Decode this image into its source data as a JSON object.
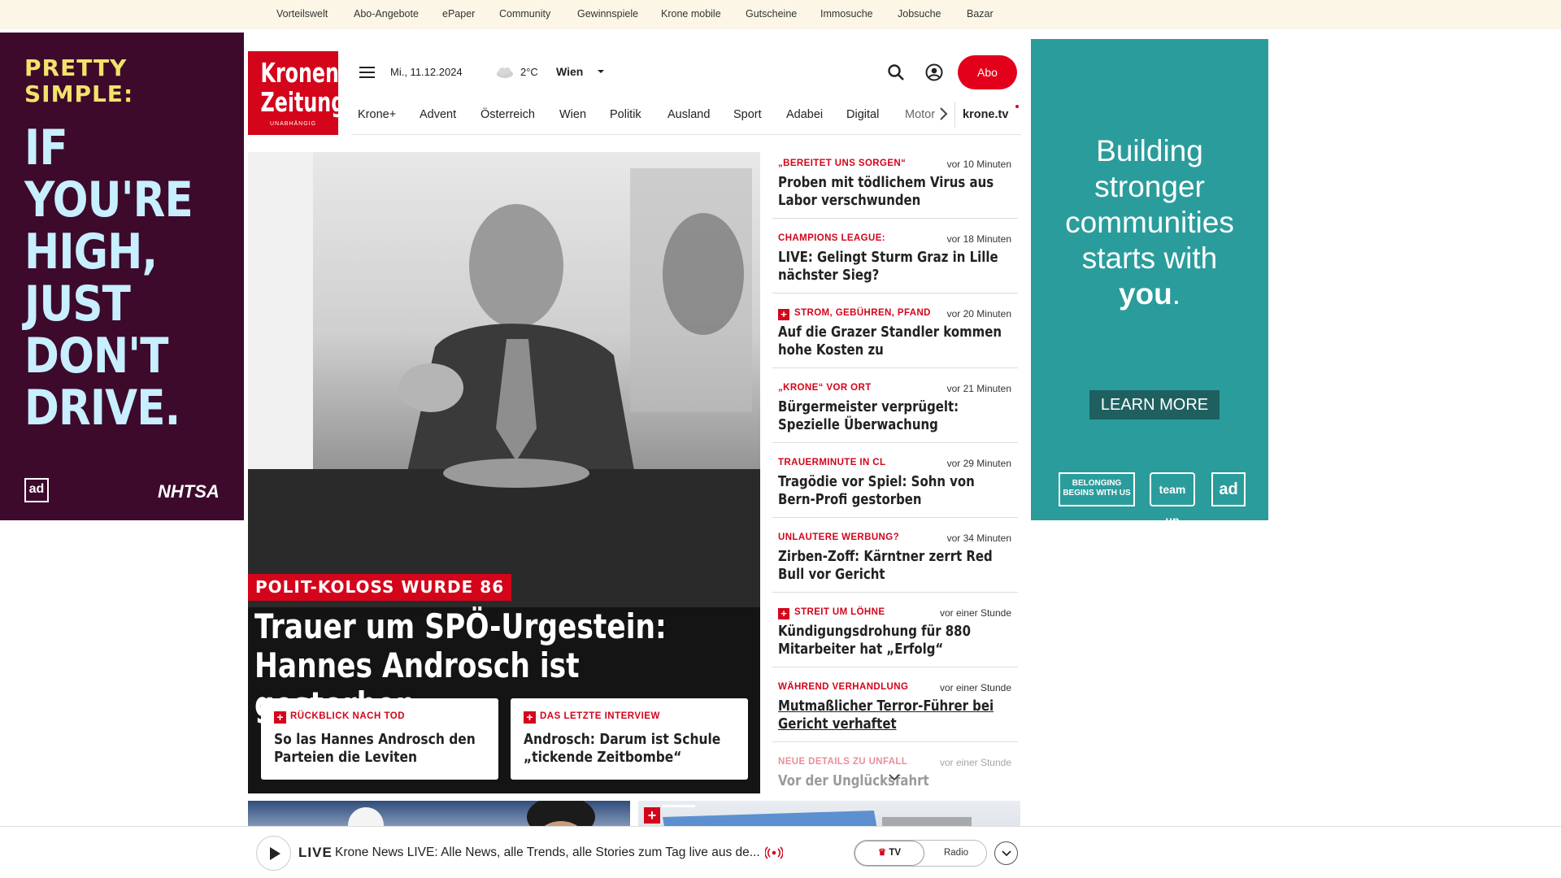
{
  "topbar": [
    "Vorteilswelt",
    "Abo-Angebote",
    "ePaper",
    "Community",
    "Gewinnspiele",
    "Krone mobile",
    "Gutscheine",
    "Immosuche",
    "Jobsuche",
    "Bazar"
  ],
  "ad_left": {
    "tagline": "PRETTY SIMPLE:",
    "headline": "IF YOU'RE HIGH, JUST DON'T DRIVE.",
    "logo1": "ad",
    "logo2": "NHTSA"
  },
  "ad_right": {
    "copy_line1": "Building",
    "copy_line2": "stronger",
    "copy_line3": "communities",
    "copy_line4": "starts with",
    "copy_bold": "you",
    "copy_end": ".",
    "button": "LEARN MORE",
    "logo1": "BELONGING BEGINS WITH US",
    "logo2": "team up",
    "logo3": "ad"
  },
  "header": {
    "logo_line1": "Kronen",
    "logo_line2": "Zeitung",
    "logo_line3": "UNABHÄNGIG",
    "date": "Mi., 11.12.2024",
    "temperature": "2°C",
    "location": "Wien",
    "abo_label": "Abo"
  },
  "nav": [
    "Krone+",
    "Advent",
    "Österreich",
    "Wien",
    "Politik",
    "Ausland",
    "Sport",
    "Adabei",
    "Digital",
    "Motor",
    "krone.tv"
  ],
  "hero": {
    "kicker": "POLIT-KOLOSS WURDE 86",
    "headline": "Trauer um SPÖ-Urgestein: Hannes Androsch ist gestorben",
    "related": [
      {
        "kicker": "RÜCKBLICK NACH TOD",
        "title": "So las Hannes Androsch den Parteien die Leviten"
      },
      {
        "kicker": "DAS LETZTE INTERVIEW",
        "title": "Androsch: Darum ist Schule „tickende Zeitbombe“"
      }
    ]
  },
  "articles": [
    {
      "kicker": "„BEREITET UNS SORGEN“",
      "time": "vor 10 Minuten",
      "title": "Proben mit tödlichem Virus aus Labor verschwunden",
      "plus": false
    },
    {
      "kicker": "CHAMPIONS LEAGUE:",
      "time": "vor 18 Minuten",
      "title": "LIVE: Gelingt Sturm Graz in Lille nächster Sieg?",
      "plus": false
    },
    {
      "kicker": "STROM, GEBÜHREN, PFAND",
      "time": "vor 20 Minuten",
      "title": "Auf die Grazer Standler kommen hohe Kosten zu",
      "plus": true
    },
    {
      "kicker": "„KRONE“ VOR ORT",
      "time": "vor 21 Minuten",
      "title": "Bürgermeister verprügelt: Spezielle Überwachung",
      "plus": false
    },
    {
      "kicker": "TRAUERMINUTE IN CL",
      "time": "vor 29 Minuten",
      "title": "Tragödie vor Spiel: Sohn von Bern-Profi gestorben",
      "plus": false
    },
    {
      "kicker": "UNLAUTERE WERBUNG?",
      "time": "vor 34 Minuten",
      "title": "Zirben-Zoff: Kärntner zerrt Red Bull vor Gericht",
      "plus": false
    },
    {
      "kicker": "STREIT UM LÖHNE",
      "time": "vor einer Stunde",
      "title": "Kündigungsdrohung für 880 Mitarbeiter hat „Erfolg“",
      "plus": true
    },
    {
      "kicker": "WÄHREND VERHANDLUNG",
      "time": "vor einer Stunde",
      "title": "Mutmaßlicher Terror-Führer bei Gericht verhaftet",
      "plus": false
    },
    {
      "kicker": "NEUE DETAILS ZU UNFALL",
      "time": "vor einer Stunde",
      "title": "Vor der Unglücksfahrt",
      "plus": false
    }
  ],
  "player": {
    "live_label": "LIVE",
    "description": "Krone News LIVE: Alle News, alle Trends, alle Stories zum Tag live aus de...",
    "tv_label": "TV",
    "radio_label": "Radio"
  },
  "colors": {
    "brand_red": "#d4041b",
    "topbar_bg": "#fbf6e6",
    "ad_left_bg": "#3d0a2c",
    "ad_right_bg": "#2b9c9c"
  }
}
